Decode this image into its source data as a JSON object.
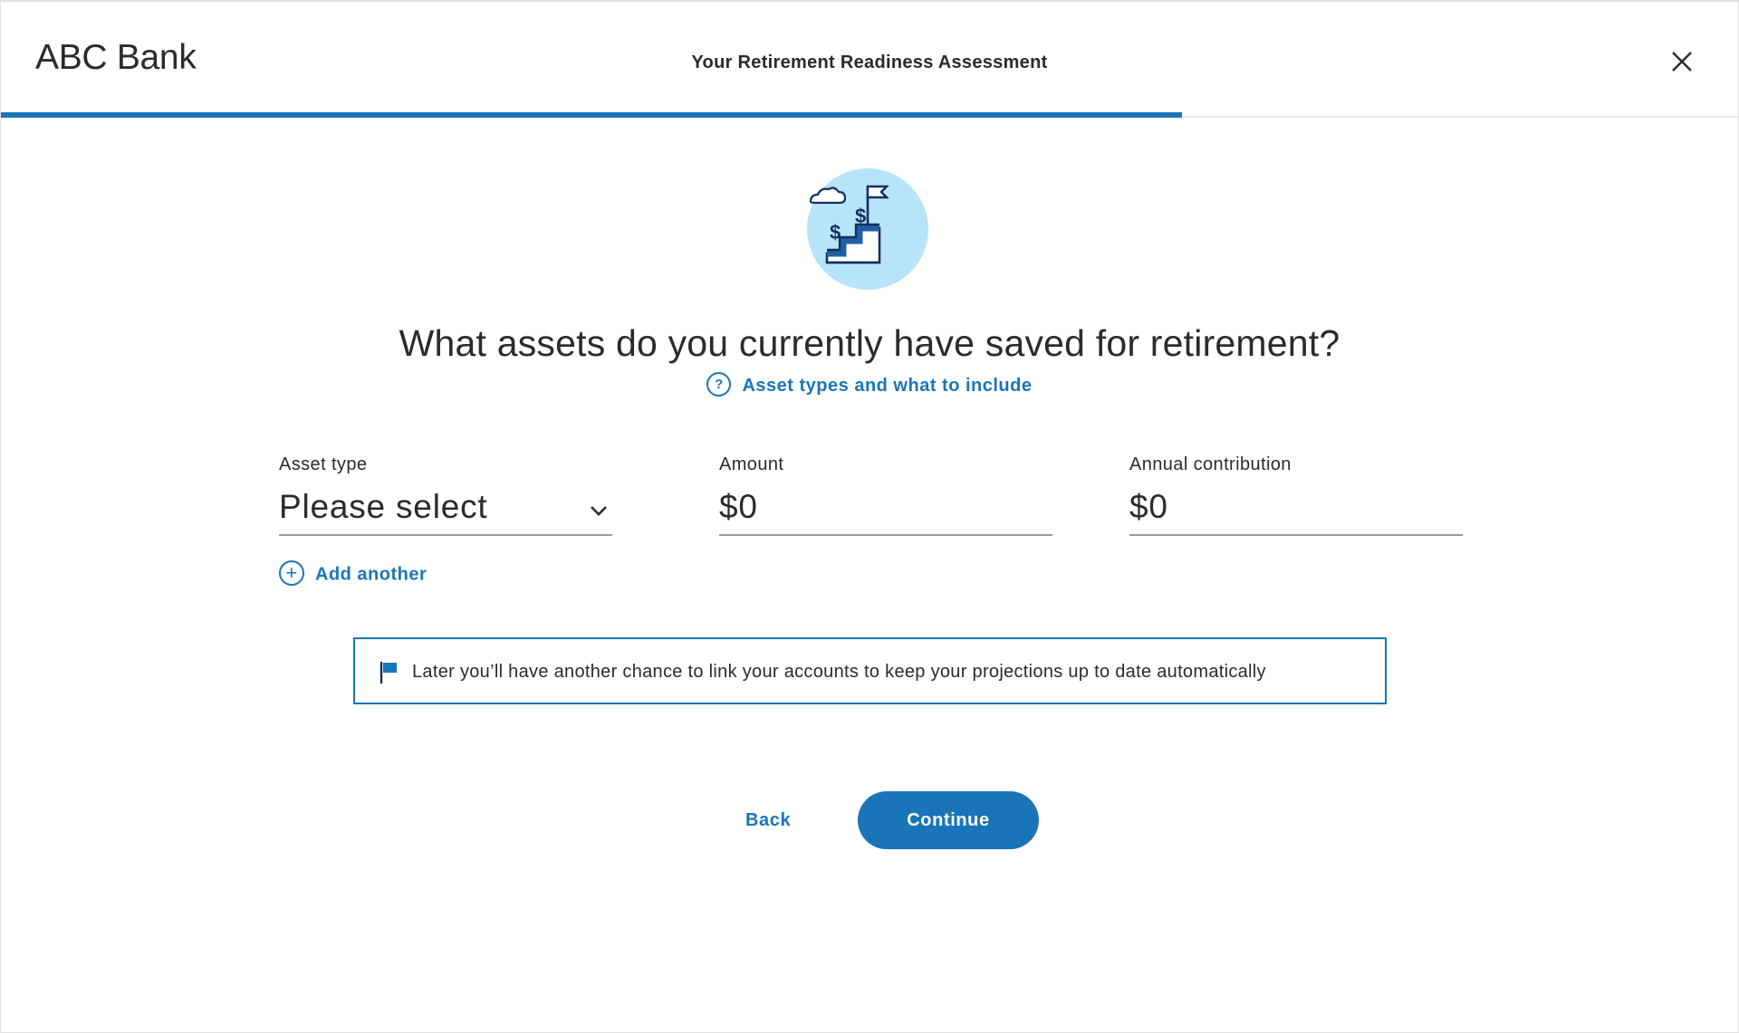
{
  "header": {
    "brand": "ABC Bank",
    "title": "Your Retirement Readiness Assessment",
    "progress_fraction": 0.68
  },
  "question": {
    "text": "What assets do you currently have saved for retirement?",
    "help_link": "Asset types and what to include",
    "help_icon_glyph": "?"
  },
  "fields": {
    "asset_type": {
      "label": "Asset type",
      "value": "Please select"
    },
    "amount": {
      "label": "Amount",
      "value": "$0"
    },
    "annual_contribution": {
      "label": "Annual contribution",
      "value": "$0"
    }
  },
  "add_another": {
    "label": "Add another",
    "icon_glyph": "+"
  },
  "notice": {
    "text": "Later you’ll have another chance to link your accounts to keep your projections up to date automatically"
  },
  "actions": {
    "back_label": "Back",
    "continue_label": "Continue"
  },
  "colors": {
    "accent": "#1a75b8",
    "illustration_bg": "#b8e4f9",
    "illustration_line": "#12305c",
    "illustration_fill": "#1f5fa3"
  }
}
